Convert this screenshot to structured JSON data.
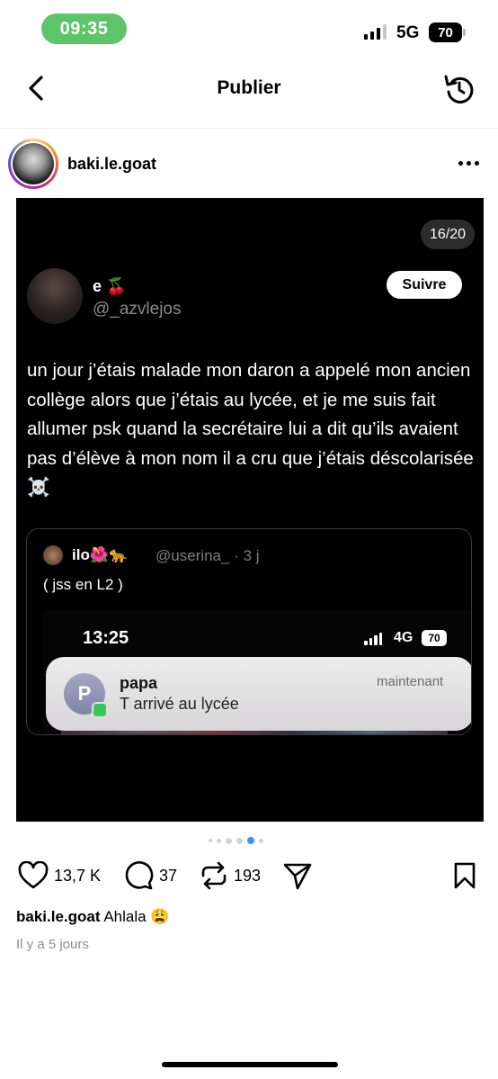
{
  "status_bar": {
    "time": "09:35",
    "network": "5G",
    "battery": "70"
  },
  "header": {
    "title": "Publier",
    "back_icon": "chevron-left-icon",
    "refresh_icon": "refresh-icon"
  },
  "author": {
    "username": "baki.le.goat",
    "more_icon": "more-horizontal-icon"
  },
  "post": {
    "slide_counter": "16/20",
    "tweet": {
      "name": "e 🍒",
      "handle": "@_azvlejos",
      "follow_label": "Suivre",
      "text": "un jour j’étais malade mon daron a appelé mon ancien collège alors que j’étais au lycée, et je me suis fait allumer psk quand la secrétaire lui a dit qu’ils avaient pas d’élève à mon nom il a cru que j’étais déscolarisée ☠️",
      "quote": {
        "name": "ilo🌺🐆",
        "meta": "@userina_ · 3 j",
        "text": "( jss en L2 )",
        "screenshot": {
          "time": "13:25",
          "network": "4G",
          "battery": "70",
          "notification": {
            "avatar_letter": "P",
            "title": "papa",
            "body": "T arrivé au lycée",
            "time": "maintenant"
          }
        }
      }
    },
    "carousel": {
      "total_dots": 6,
      "active_index": 4
    }
  },
  "actions": {
    "likes": "13,7 K",
    "comments": "37",
    "reposts": "193"
  },
  "caption": {
    "username": "baki.le.goat",
    "text": "Ahlala 😩"
  },
  "timestamp": "Il y a 5 jours",
  "colors": {
    "status_pill": "#5dc46a",
    "active_dot": "#3897f0"
  }
}
